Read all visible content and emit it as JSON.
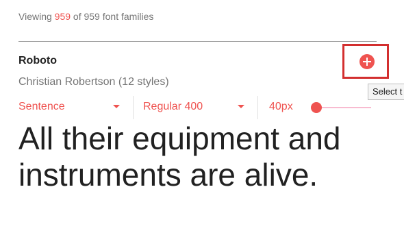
{
  "header": {
    "viewing_prefix": "Viewing",
    "viewing_count": "959",
    "viewing_suffix": "of 959 font families"
  },
  "font_card": {
    "family_name": "Roboto",
    "designer_line": "Christian Robertson (12 styles)",
    "add_button_icon": "plus-circle-icon",
    "tooltip": "Select t",
    "controls": {
      "preview_mode": "Sentence",
      "weight": "Regular 400",
      "size_label": "40px"
    },
    "preview_text": "All their equipment and instruments are alive."
  },
  "colors": {
    "accent": "#ef5350",
    "highlight_frame": "#d32f2f",
    "text_primary": "#212121",
    "text_secondary": "#757575"
  }
}
